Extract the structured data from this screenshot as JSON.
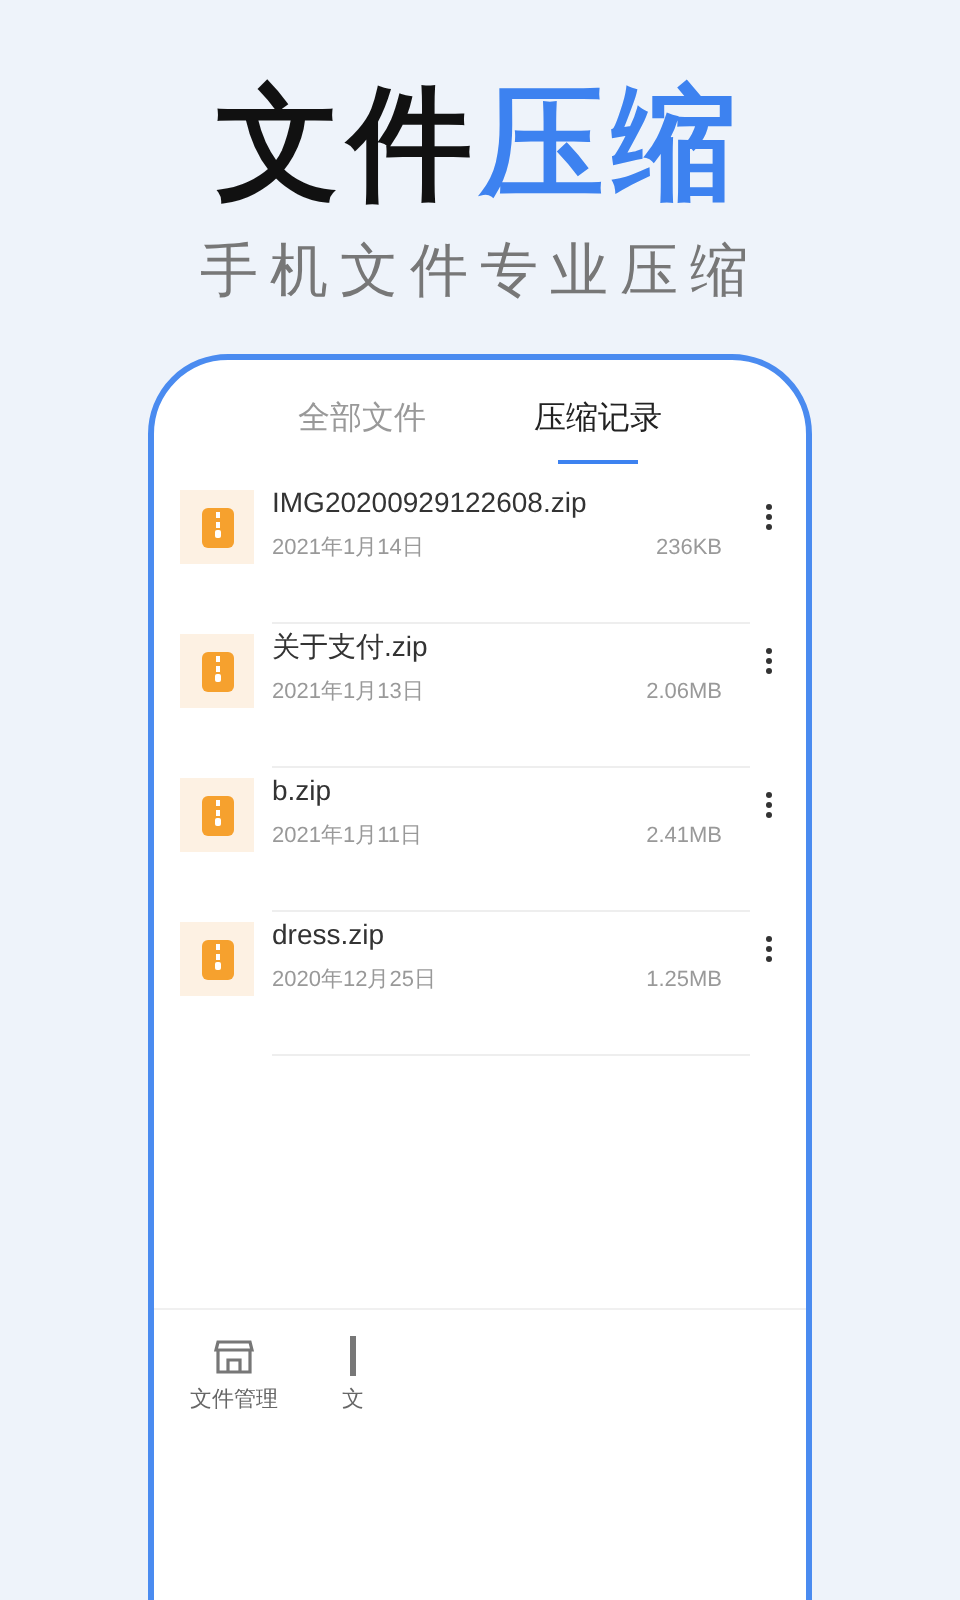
{
  "headline": {
    "main": "文件",
    "accent": "压缩"
  },
  "subtitle": "手机文件专业压缩",
  "tabs": [
    {
      "label": "全部文件",
      "selected": false
    },
    {
      "label": "压缩记录",
      "selected": true
    }
  ],
  "files": [
    {
      "name": "IMG20200929122608.zip",
      "date": "2021年1月14日",
      "size": "236KB"
    },
    {
      "name": "关于支付.zip",
      "date": "2021年1月13日",
      "size": "2.06MB"
    },
    {
      "name": "b.zip",
      "date": "2021年1月11日",
      "size": "2.41MB"
    },
    {
      "name": "dress.zip",
      "date": "2020年12月25日",
      "size": "1.25MB"
    }
  ],
  "bottom_nav": [
    {
      "label": "文件管理",
      "kind": "store"
    },
    {
      "label": "文",
      "kind": "doc"
    }
  ]
}
